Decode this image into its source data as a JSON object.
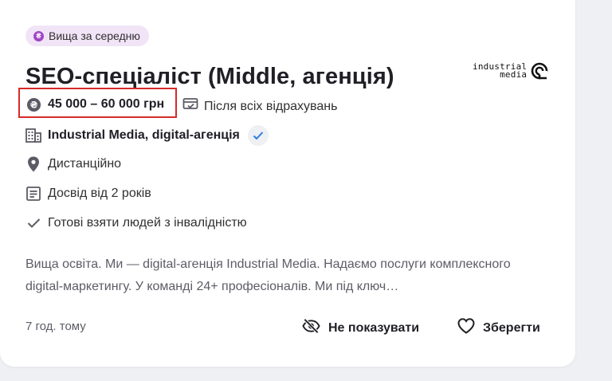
{
  "badge": {
    "label": "Вища за середню",
    "icon": "coin-icon",
    "color": "#a145c4"
  },
  "vacancy": {
    "title": "SEO-спеціаліст (Middle, агенція)",
    "salary": "45 000 – 60 000 грн",
    "salary_note": "Після всіх відрахувань",
    "company": "Industrial Media, digital-агенція",
    "location": "Дистанційно",
    "experience": "Досвід від 2 років",
    "inclusion": "Готові взяти людей з інвалідністю",
    "description": "Вища освіта. Ми — digital-агенція Industrial Media. Надаємо послуги комплексного digital-маркетингу. У команді 24+ професіоналів. Ми під ключ…"
  },
  "logo": {
    "line1": "industrial",
    "line2": "media"
  },
  "footer": {
    "posted": "7 год. тому",
    "hide_label": "Не показувати",
    "save_label": "Зберегти"
  },
  "colors": {
    "highlight_border": "#d52a2a",
    "verified": "#2d7be0"
  }
}
